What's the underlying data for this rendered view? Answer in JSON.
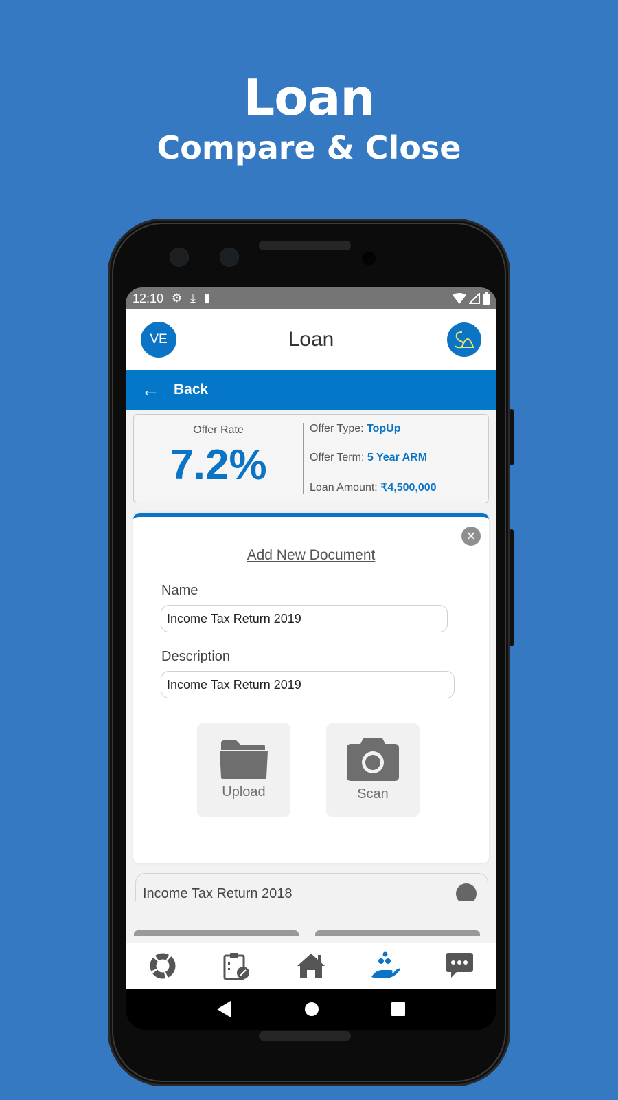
{
  "promo": {
    "title": "Loan",
    "subtitle": "Compare & Close"
  },
  "status_bar": {
    "time": "12:10",
    "left_icons": [
      "gear-icon",
      "download-icon",
      "sd-card-icon"
    ],
    "right_icons": [
      "wifi-icon",
      "signal-icon",
      "battery-icon"
    ]
  },
  "app_bar": {
    "avatar_initials": "VE",
    "title": "Loan",
    "logo_text": "SD"
  },
  "back_bar": {
    "label": "Back"
  },
  "offer": {
    "rate_label": "Offer Rate",
    "rate_value": "7.2%",
    "type_label": "Offer Type:",
    "type_value": "TopUp",
    "term_label": "Offer Term:",
    "term_value": "5 Year ARM",
    "amount_label": "Loan Amount:",
    "amount_value": "₹4,500,000"
  },
  "modal": {
    "title": "Add New Document",
    "name_label": "Name",
    "name_value": "Income Tax Return 2019",
    "description_label": "Description",
    "description_value": "Income Tax Return 2019",
    "upload_label": "Upload",
    "scan_label": "Scan"
  },
  "documents": [
    {
      "name": "Income Tax Return 2018"
    }
  ],
  "tabs": [
    {
      "icon": "donut-chart-icon",
      "active": false
    },
    {
      "icon": "clipboard-edit-icon",
      "active": false
    },
    {
      "icon": "home-icon",
      "active": false
    },
    {
      "icon": "hand-coins-icon",
      "active": true
    },
    {
      "icon": "chat-bubble-icon",
      "active": false
    }
  ],
  "colors": {
    "background": "#3479c1",
    "primary": "#0b74c4",
    "back_bar": "#0577c8",
    "status_bar": "#757575",
    "icon_gray": "#555555"
  }
}
